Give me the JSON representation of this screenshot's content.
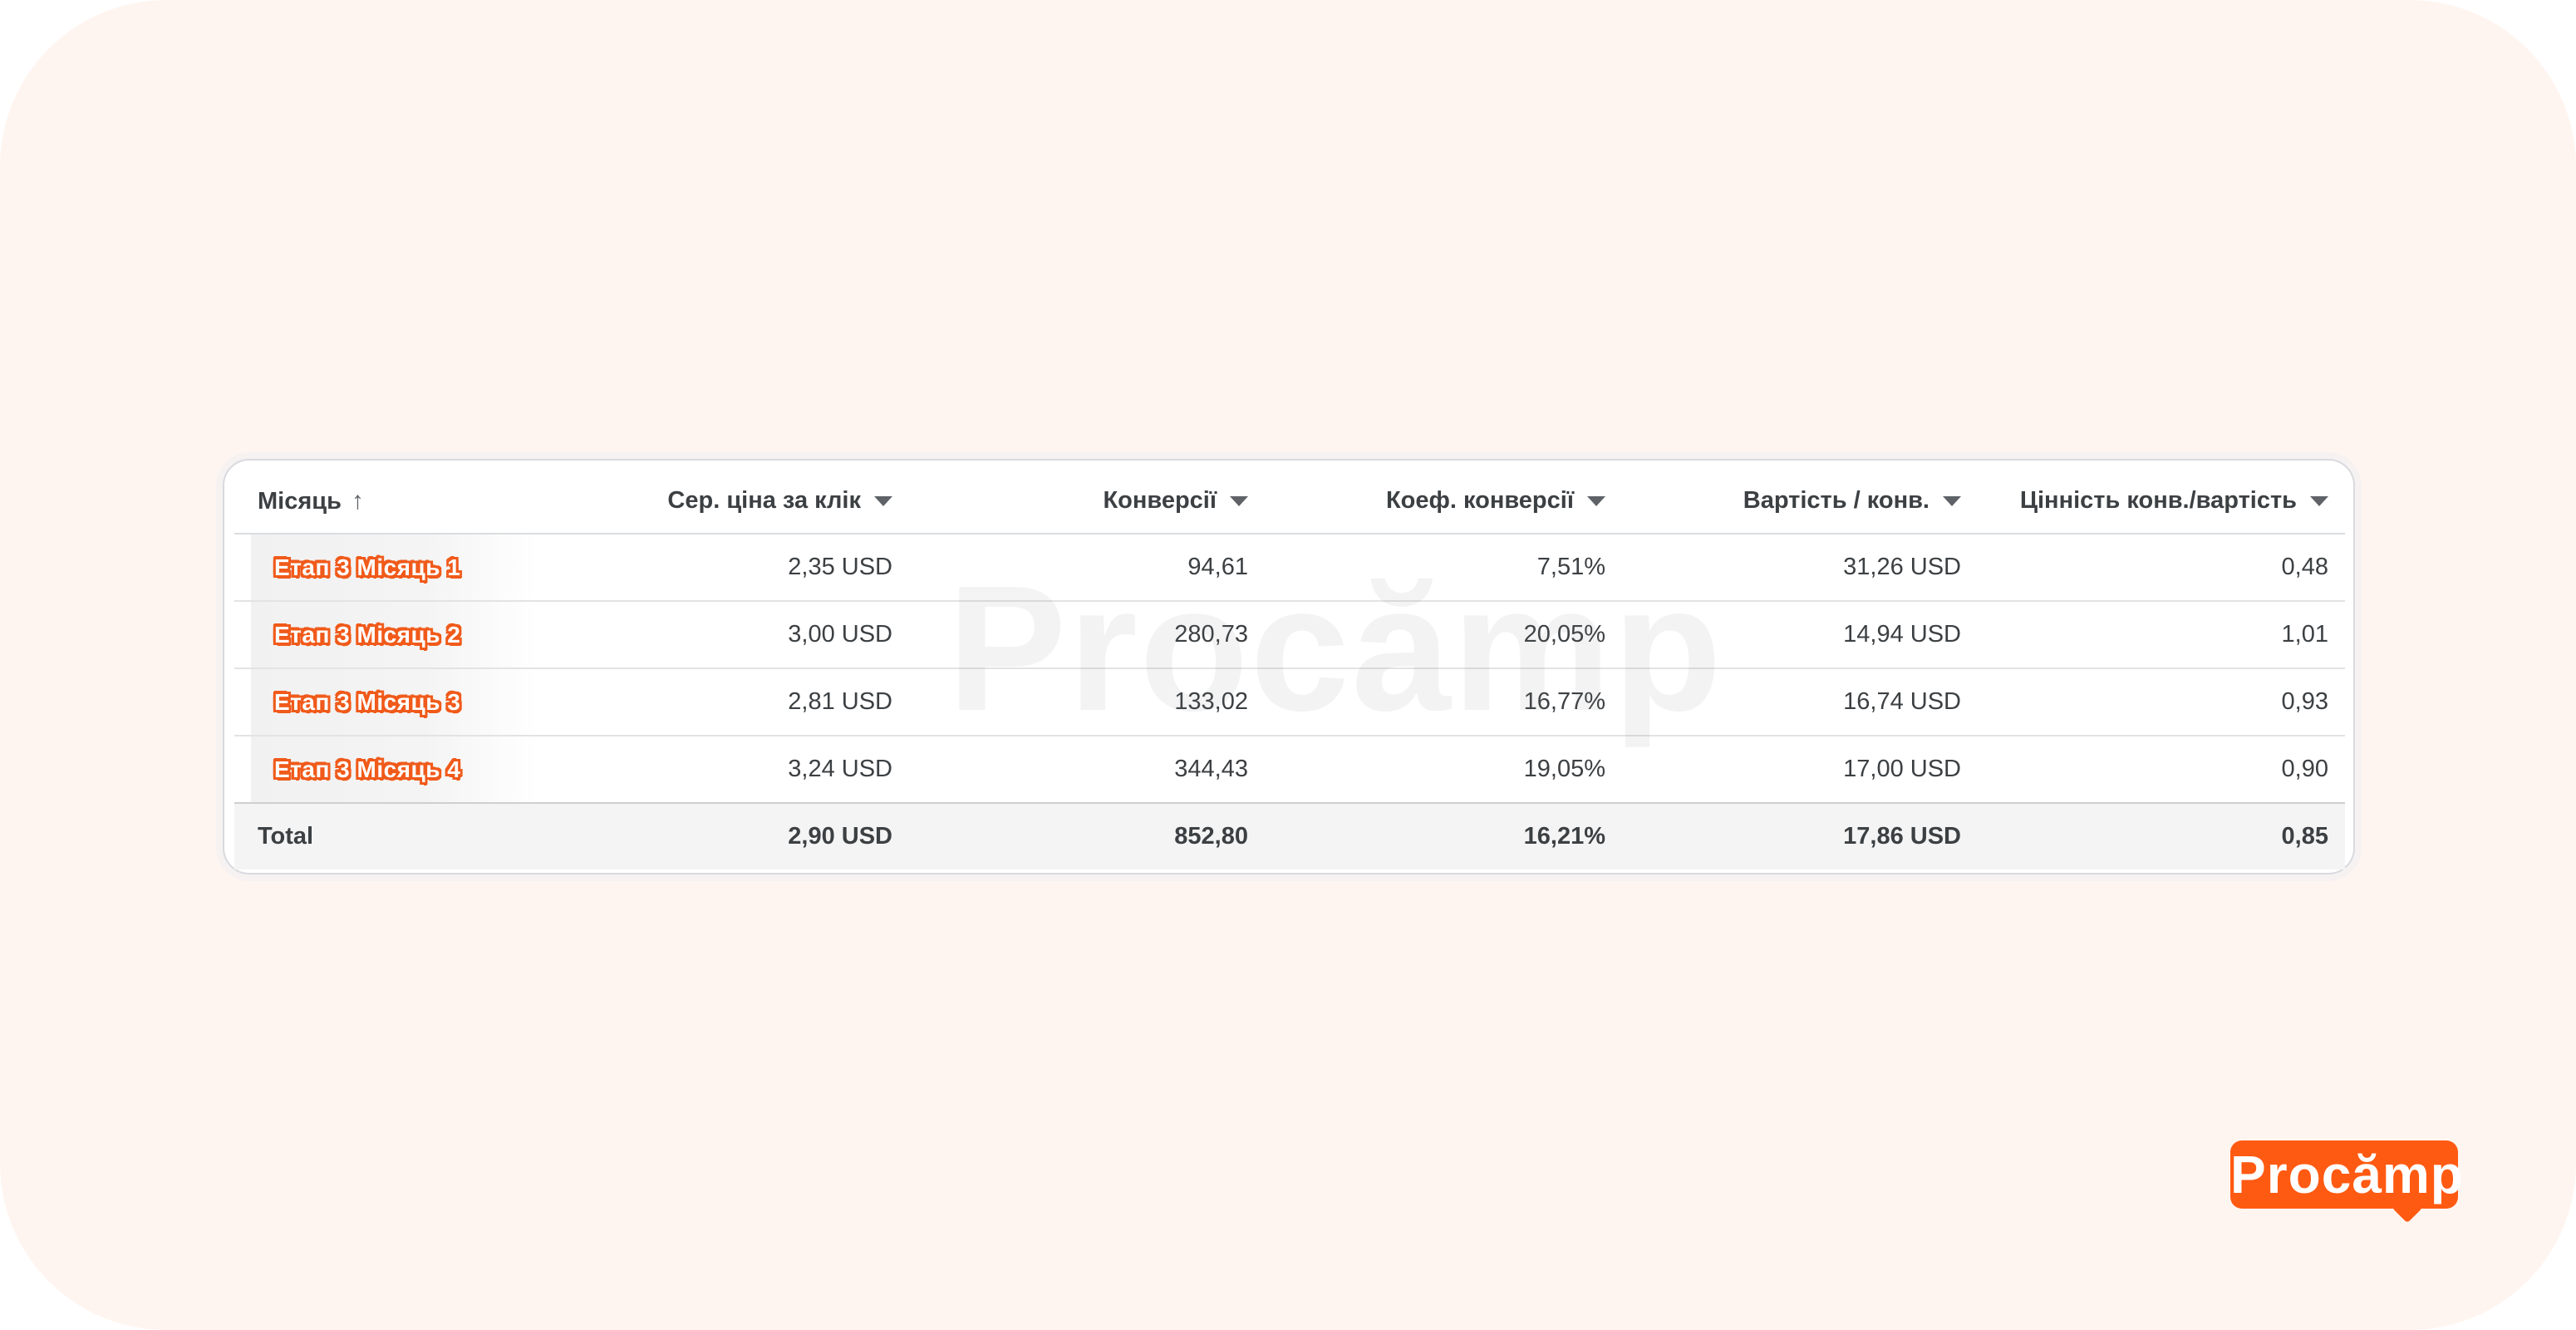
{
  "table": {
    "columns": [
      {
        "label": "Місяць",
        "sort": "asc"
      },
      {
        "label": "Сер. ціна за клік",
        "sort": "menu"
      },
      {
        "label": "Конверсії",
        "sort": "menu"
      },
      {
        "label": "Коеф. конверсії",
        "sort": "menu"
      },
      {
        "label": "Вартість / конв.",
        "sort": "menu"
      },
      {
        "label": "Цінність конв./вартість",
        "sort": "menu"
      }
    ],
    "rows": [
      {
        "month": "Етап 3 Місяць 1",
        "cpc": "2,35 USD",
        "conversions": "94,61",
        "conv_rate": "7,51%",
        "cost_per_conv": "31,26 USD",
        "value_cost": "0,48"
      },
      {
        "month": "Етап 3 Місяць 2",
        "cpc": "3,00 USD",
        "conversions": "280,73",
        "conv_rate": "20,05%",
        "cost_per_conv": "14,94 USD",
        "value_cost": "1,01"
      },
      {
        "month": "Етап 3 Місяць 3",
        "cpc": "2,81 USD",
        "conversions": "133,02",
        "conv_rate": "16,77%",
        "cost_per_conv": "16,74 USD",
        "value_cost": "0,93"
      },
      {
        "month": "Етап 3 Місяць 4",
        "cpc": "3,24 USD",
        "conversions": "344,43",
        "conv_rate": "19,05%",
        "cost_per_conv": "17,00 USD",
        "value_cost": "0,90"
      }
    ],
    "total": {
      "label": "Total",
      "cpc": "2,90 USD",
      "conversions": "852,80",
      "conv_rate": "16,21%",
      "cost_per_conv": "17,86 USD",
      "value_cost": "0,85"
    }
  },
  "watermark": "Procămp",
  "logo": {
    "text": "Procămp",
    "color": "#ff5a12"
  },
  "colors": {
    "background": "#fff5f0",
    "accent": "#f05a1a",
    "text": "#3c4043"
  },
  "icons": {
    "sort_asc": "arrow-up-icon",
    "sort_menu": "caret-down-icon"
  }
}
